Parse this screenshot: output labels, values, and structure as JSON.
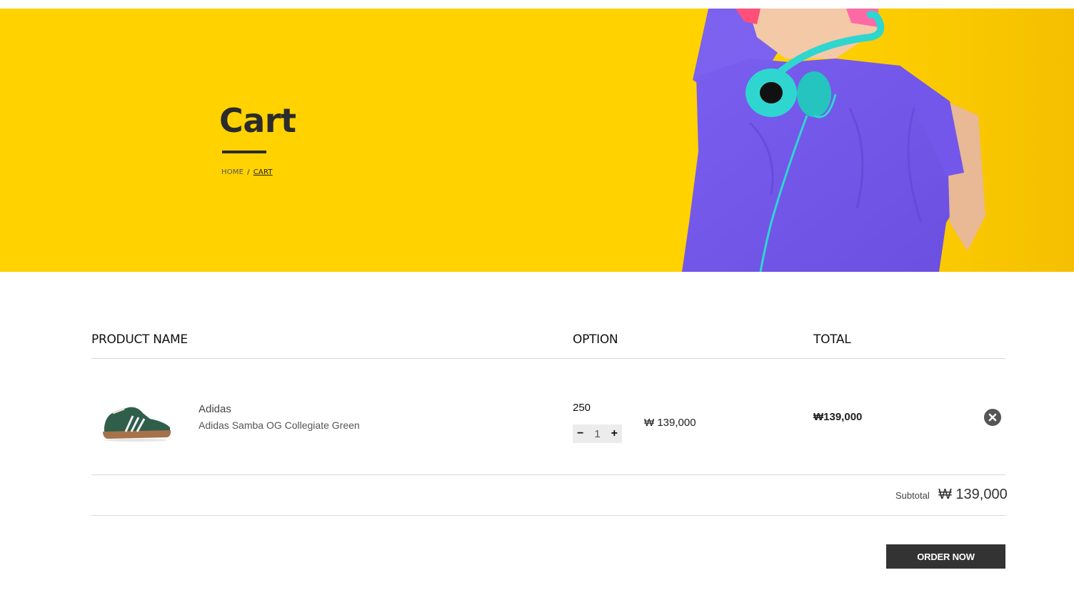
{
  "hero": {
    "title": "Cart",
    "breadcrumb": {
      "home": "HOME",
      "separator": "/",
      "current": "CART"
    },
    "background_color": "#ffd200"
  },
  "table": {
    "headers": {
      "product": "PRODUCT NAME",
      "option": "OPTION",
      "total": "TOTAL"
    }
  },
  "item": {
    "brand": "Adidas",
    "name": "Adidas Samba OG Collegiate Green",
    "size": "250",
    "quantity": "1",
    "decrement_label": "−",
    "increment_label": "+",
    "unit_price": "₩ 139,000",
    "total": "₩139,000"
  },
  "summary": {
    "subtotal_label": "Subtotal",
    "subtotal_value": "₩ 139,000"
  },
  "actions": {
    "order_now": "ORDER NOW"
  },
  "icons": {
    "remove": "close-circle-icon",
    "product_image": "sneaker-thumbnail"
  }
}
